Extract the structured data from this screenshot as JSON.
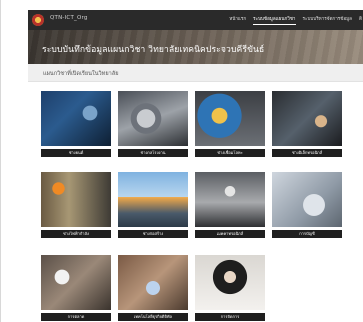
{
  "header": {
    "brand": "QTN-ICT_Org",
    "nav": [
      {
        "label": "หน้าแรก",
        "active": false
      },
      {
        "label": "ระบบข้อมูลแผนกวิชา",
        "active": true
      },
      {
        "label": "ระบบบริหารจัดการข้อมูล",
        "active": false
      },
      {
        "label": "ติ",
        "active": false
      }
    ]
  },
  "hero": {
    "title": "ระบบบันทึกข้อมูลแผนกวิชา วิทยาลัยเทคนิคประจวบคีรีขันธ์"
  },
  "section": {
    "title": "แผนกวิชาที่เปิดเรียนในวิทยาลัย"
  },
  "departments": [
    {
      "label": "ช่างยนต์",
      "image": "auto-repair-photo"
    },
    {
      "label": "ช่างกลโรงงาน",
      "image": "machine-shop-photo"
    },
    {
      "label": "ช่างเชื่อมโลหะ",
      "image": "welding-photo"
    },
    {
      "label": "ช่างอิเล็กทรอนิกส์",
      "image": "electronics-photo"
    },
    {
      "label": "ช่างไฟฟ้ากำลัง",
      "image": "electrical-power-photo"
    },
    {
      "label": "ช่างก่อสร้าง",
      "image": "construction-photo"
    },
    {
      "label": "เมคคาทรอนิกส์",
      "image": "mechatronics-photo"
    },
    {
      "label": "การบัญชี",
      "image": "accounting-photo"
    },
    {
      "label": "การตลาด",
      "image": "marketing-photo"
    },
    {
      "label": "เทคโนโลยีธุรกิจดิจิทัล",
      "image": "digital-business-photo"
    },
    {
      "label": "การจัดการ",
      "image": "business-management-photo"
    }
  ]
}
